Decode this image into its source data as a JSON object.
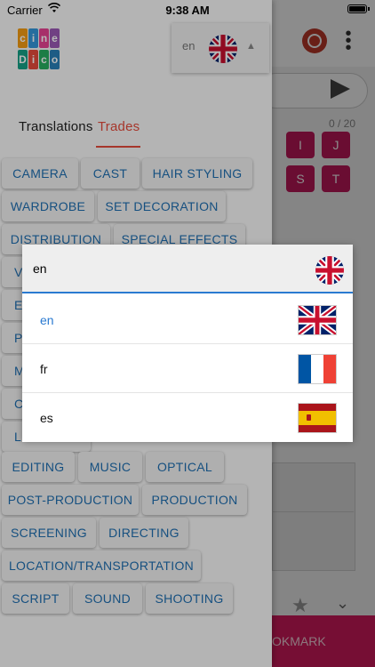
{
  "status_bar": {
    "carrier": "Carrier",
    "time": "9:38 AM"
  },
  "app": {
    "logo_letters": [
      "c",
      "i",
      "n",
      "e",
      "D",
      "i",
      "c",
      "o"
    ],
    "language_selector": {
      "value": "en"
    }
  },
  "background": {
    "counter": "0 / 20",
    "letters_row1": [
      "I",
      "J"
    ],
    "letters_row2": [
      "S",
      "T"
    ],
    "bookmark_label": "OKMARK"
  },
  "tabs": [
    {
      "label": "Translations",
      "active": false
    },
    {
      "label": "Trades",
      "active": true
    }
  ],
  "trades": [
    "CAMERA",
    "CAST",
    "HAIR STYLING",
    "WARDROBE",
    "SET DECORATION",
    "DISTRIBUTION",
    "SPECIAL EFFECTS",
    "V",
    "E",
    "P",
    "M",
    "C",
    "L",
    "EDITING",
    "MUSIC",
    "OPTICAL",
    "POST-PRODUCTION",
    "PRODUCTION",
    "SCREENING",
    "DIRECTING",
    "LOCATION/TRANSPORTATION",
    "SCRIPT",
    "SOUND",
    "SHOOTING"
  ],
  "language_dropdown": {
    "current": "en",
    "options": [
      {
        "code": "en",
        "selected": true,
        "flag": "uk-flag-icon"
      },
      {
        "code": "fr",
        "selected": false,
        "flag": "france-flag-icon"
      },
      {
        "code": "es",
        "selected": false,
        "flag": "spain-flag-icon"
      }
    ]
  },
  "colors": {
    "accent_red": "#e74c3c",
    "chip_text": "#1f6fb2",
    "selected_blue": "#2a7ad1",
    "bookmark_bg": "#d81b60"
  }
}
